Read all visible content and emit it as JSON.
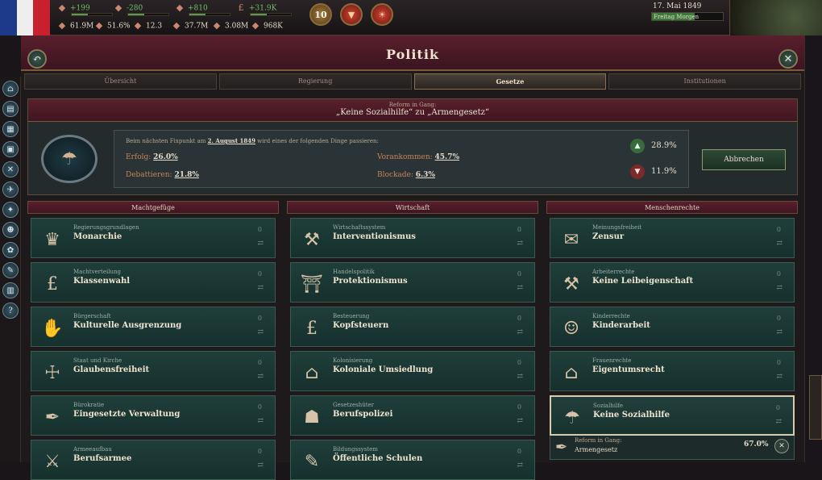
{
  "topbar": {
    "row1": [
      {
        "icon": "budget-icon",
        "value": "+199",
        "cls": "g"
      },
      {
        "icon": "heart-icon",
        "value": "-280",
        "cls": "g"
      },
      {
        "icon": "dove-icon",
        "value": "+810",
        "cls": "g"
      },
      {
        "icon": "pound-icon",
        "glyph": "£",
        "value": "+31.9K",
        "cls": "g"
      }
    ],
    "row2": [
      {
        "icon": "population-icon",
        "value": "61.9M"
      },
      {
        "icon": "literacy-icon",
        "value": "51.6%"
      },
      {
        "icon": "gdp-icon",
        "value": "12.3"
      },
      {
        "icon": "workforce-icon",
        "value": "37.7M"
      },
      {
        "icon": "army-icon",
        "value": "3.08M"
      },
      {
        "icon": "prestige-icon",
        "value": "968K"
      }
    ],
    "authority_badge": "10",
    "date": "17. Mai 1849",
    "speed_label": "Freitag Morgen"
  },
  "panel": {
    "title": "Politik",
    "tabs": [
      "Übersicht",
      "Regierung",
      "Gesetze",
      "Institutionen"
    ],
    "active_tab": "Gesetze"
  },
  "reform": {
    "line1": "Reform in Gang:",
    "line2": "„Keine Sozialhilfe“ zu „Armengesetz“",
    "checkpoint_prefix": "Beim nächsten Fixpunkt am",
    "checkpoint_date": "2. August 1849",
    "checkpoint_suffix": "wird eines der folgenden Dinge passieren:",
    "outcomes": {
      "success_label": "Erfolg:",
      "success_value": "26.0%",
      "progress_label": "Vorankommen:",
      "progress_value": "45.7%",
      "debate_label": "Debattieren:",
      "debate_value": "21.8%",
      "block_label": "Blockade:",
      "block_value": "6.3%"
    },
    "support_pct": "28.9%",
    "oppose_pct": "11.9%",
    "cancel_label": "Abbrechen"
  },
  "columns": [
    {
      "title": "Machtgefüge",
      "laws": [
        {
          "cat": "Regierungsgrundlagen",
          "name": "Monarchie",
          "icon": "crown-icon",
          "glyph": "♛",
          "n": "0"
        },
        {
          "cat": "Machtverteilung",
          "name": "Klassenwahl",
          "icon": "pound-sign-icon",
          "glyph": "£",
          "n": "0"
        },
        {
          "cat": "Bürgerschaft",
          "name": "Kulturelle Ausgrenzung",
          "icon": "warning-hand-icon",
          "glyph": "✋",
          "n": "0"
        },
        {
          "cat": "Staat und Kirche",
          "name": "Glaubensfreiheit",
          "icon": "praying-hands-icon",
          "glyph": "☩",
          "n": "0"
        },
        {
          "cat": "Bürokratie",
          "name": "Eingesetzte Verwaltung",
          "icon": "quill-icon",
          "glyph": "✒",
          "n": "0"
        },
        {
          "cat": "Armeeaufbau",
          "name": "Berufsarmee",
          "icon": "soldier-icon",
          "glyph": "⚔",
          "n": "0"
        }
      ]
    },
    {
      "title": "Wirtschaft",
      "laws": [
        {
          "cat": "Wirtschaftssystem",
          "name": "Interventionismus",
          "icon": "factory-icon",
          "glyph": "⚒",
          "n": "0"
        },
        {
          "cat": "Handelspolitik",
          "name": "Protektionismus",
          "icon": "gate-icon",
          "glyph": "⛩",
          "n": "0"
        },
        {
          "cat": "Besteuerung",
          "name": "Kopfsteuern",
          "icon": "money-bag-icon",
          "glyph": "£",
          "n": "0"
        },
        {
          "cat": "Kolonisierung",
          "name": "Koloniale Umsiedlung",
          "icon": "house-icon",
          "glyph": "⌂",
          "n": "0"
        },
        {
          "cat": "Gesetzeshüter",
          "name": "Berufspolizei",
          "icon": "police-helmet-icon",
          "glyph": "☗",
          "n": "0"
        },
        {
          "cat": "Bildungssystem",
          "name": "Öffentliche Schulen",
          "icon": "books-icon",
          "glyph": "✎",
          "n": "0"
        }
      ]
    },
    {
      "title": "Menschenrechte",
      "laws": [
        {
          "cat": "Meinungsfreiheit",
          "name": "Zensur",
          "icon": "speech-bubble-icon",
          "glyph": "✉",
          "n": "0"
        },
        {
          "cat": "Arbeiterrechte",
          "name": "Keine Leibeigenschaft",
          "icon": "tools-icon",
          "glyph": "⚒",
          "n": "0"
        },
        {
          "cat": "Kinderrechte",
          "name": "Kinderarbeit",
          "icon": "child-icon",
          "glyph": "☺",
          "n": "0"
        },
        {
          "cat": "Frauenrechte",
          "name": "Eigentumsrecht",
          "icon": "building-icon",
          "glyph": "⌂",
          "n": "0"
        },
        {
          "cat": "Sozialhilfe",
          "name": "Keine Sozialhilfe",
          "icon": "rags-icon",
          "glyph": "☂",
          "n": "0",
          "selected": true
        }
      ],
      "sub_reform": {
        "a": "Reform in Gang:",
        "b": "Armengesetz",
        "pct": "67.0%"
      }
    }
  ]
}
